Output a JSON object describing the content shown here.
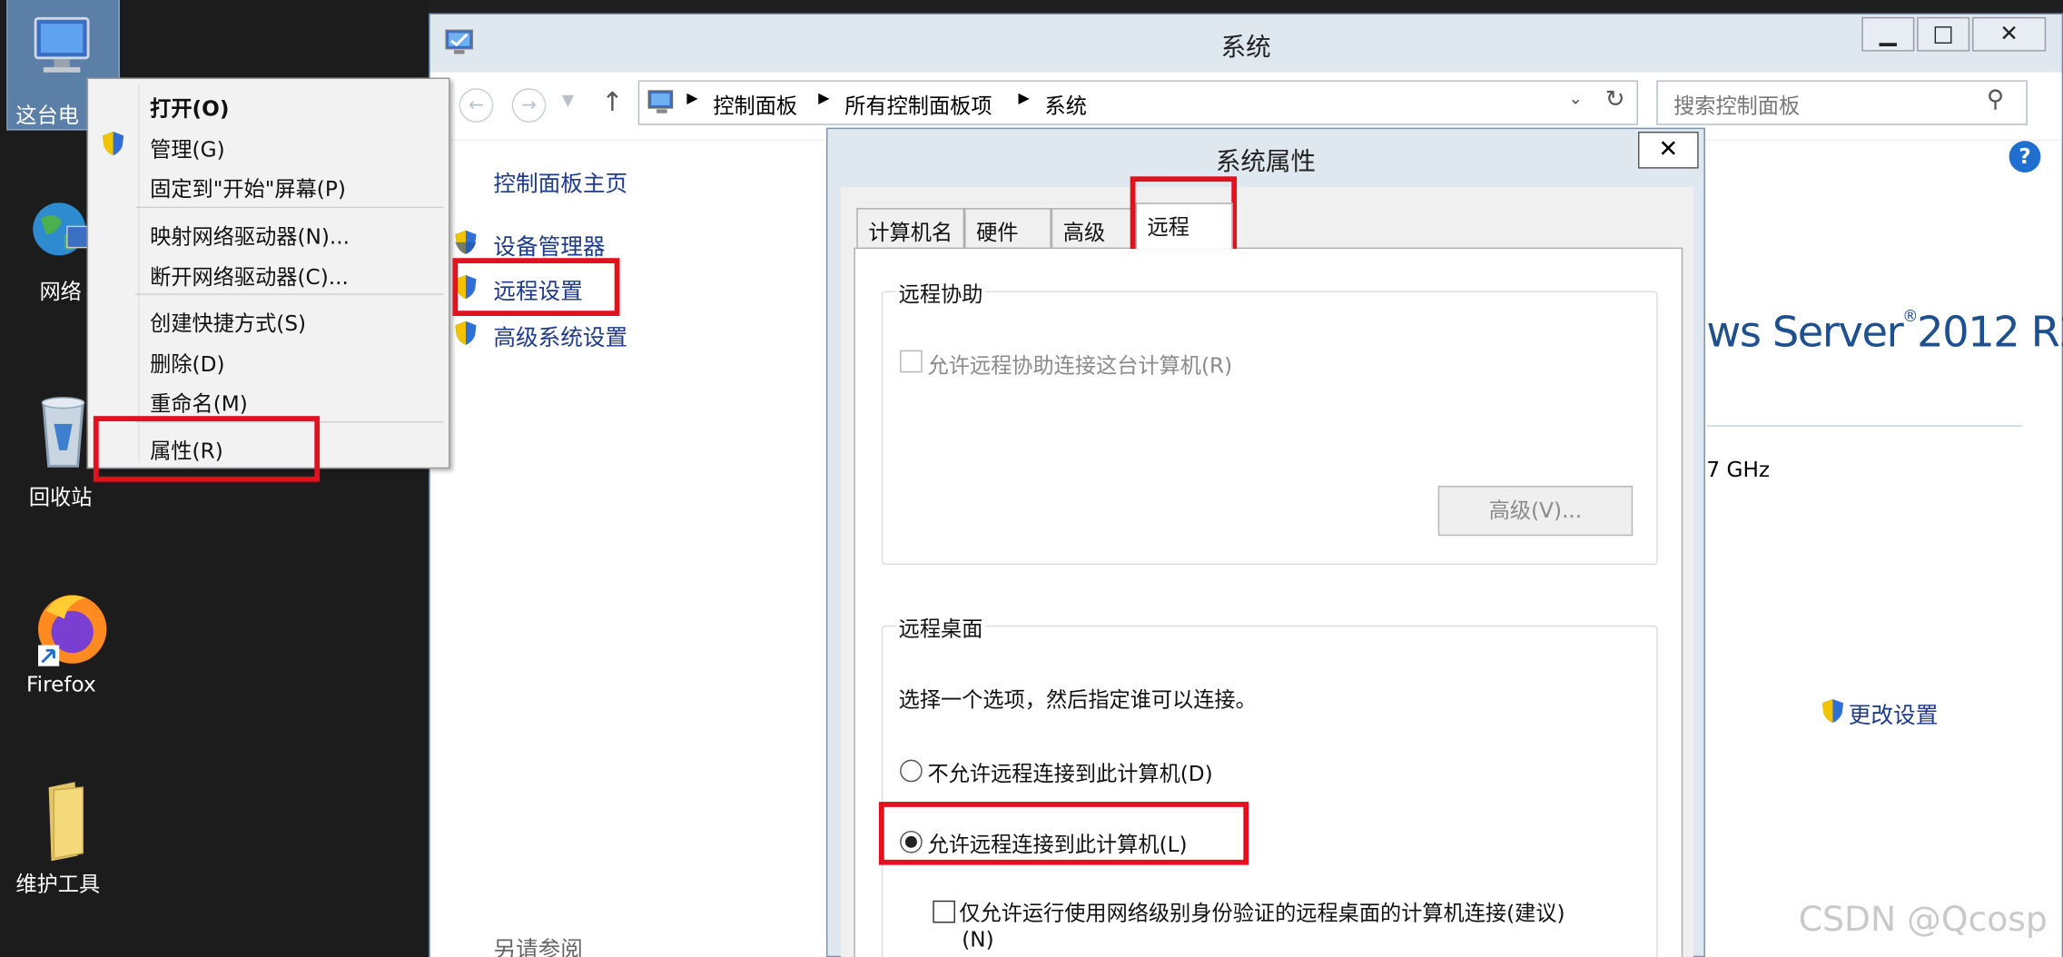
{
  "desktop": {
    "icons": [
      {
        "label": "这台电",
        "icon": "computer-icon"
      },
      {
        "label": "网络",
        "icon": "network-globe-icon"
      },
      {
        "label": "回收站",
        "icon": "recycle-bin-icon"
      },
      {
        "label": "Firefox",
        "icon": "firefox-icon"
      },
      {
        "label": "维护工具",
        "icon": "folder-icon"
      }
    ]
  },
  "context_menu": {
    "items": [
      {
        "label": "打开(O)",
        "bold": true
      },
      {
        "label": "管理(G)",
        "icon": "shield-icon"
      },
      {
        "label": "固定到\"开始\"屏幕(P)"
      },
      {
        "label": "映射网络驱动器(N)..."
      },
      {
        "label": "断开网络驱动器(C)..."
      },
      {
        "label": "创建快捷方式(S)"
      },
      {
        "label": "删除(D)"
      },
      {
        "label": "重命名(M)"
      },
      {
        "label": "属性(R)"
      }
    ]
  },
  "system_window": {
    "title": "系统",
    "controls": {
      "minimize": "▁",
      "maximize": "□",
      "close": "✕"
    },
    "breadcrumb": [
      "控制面板",
      "所有控制面板项",
      "系统"
    ],
    "search_placeholder": "搜索控制面板",
    "left_pane": {
      "home": "控制面板主页",
      "links": [
        "设备管理器",
        "远程设置",
        "高级系统设置"
      ],
      "see_also": "另请参阅"
    },
    "right_pane": {
      "os_brand": "ws Server",
      "os_version": "2012 R2",
      "cpu_fragment": "7 GHz",
      "change_settings": "更改设置",
      "help": "?"
    }
  },
  "dialog": {
    "title": "系统属性",
    "close": "✕",
    "tabs": [
      "计算机名",
      "硬件",
      "高级",
      "远程"
    ],
    "active_tab": "远程",
    "remote_assistance": {
      "group_label": "远程协助",
      "checkbox_label": "允许远程协助连接这台计算机(R)",
      "checked": false,
      "enabled": false,
      "advanced_button": "高级(V)..."
    },
    "remote_desktop": {
      "group_label": "远程桌面",
      "instruction": "选择一个选项，然后指定谁可以连接。",
      "option_disallow": "不允许远程连接到此计算机(D)",
      "option_allow": "允许远程连接到此计算机(L)",
      "selected": "allow",
      "nla_label_line1": "仅允许运行使用网络级别身份验证的远程桌面的计算机连接(建议)",
      "nla_label_line2": "(N)",
      "nla_checked": false
    }
  },
  "watermark": "CSDN @Qcosp",
  "colors": {
    "highlight": "#e3101e",
    "link": "#1e3a8a",
    "window_frame": "#dfe7ef"
  }
}
